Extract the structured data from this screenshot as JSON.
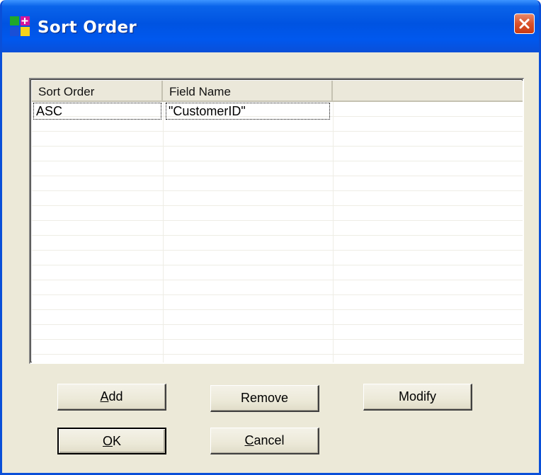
{
  "window": {
    "title": "Sort Order",
    "close_icon": "close-x-icon",
    "app_icon": "colored-squares-icon",
    "colors": {
      "titlebar": "#0053e1",
      "close": "#d9512a",
      "face": "#ece9d8"
    }
  },
  "list": {
    "columns": [
      "Sort Order",
      "Field Name",
      ""
    ],
    "rows": [
      {
        "sort_order": "ASC",
        "field_name": "\"CustomerID\""
      }
    ]
  },
  "buttons": {
    "add": {
      "mnemonic": "A",
      "rest": "dd"
    },
    "remove": {
      "label": "Remove"
    },
    "modify": {
      "label": "Modify"
    },
    "ok": {
      "mnemonic": "O",
      "rest": "K"
    },
    "cancel": {
      "mnemonic": "C",
      "rest": "ancel"
    }
  }
}
